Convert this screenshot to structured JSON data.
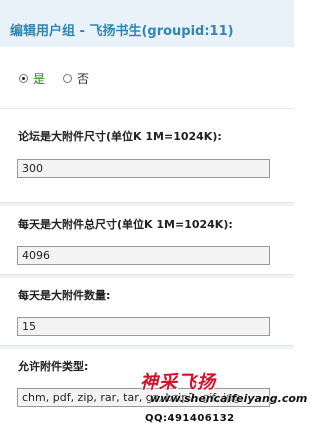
{
  "header": {
    "title": "编辑用户组 - 飞扬书生(groupid:11)"
  },
  "permission": {
    "options": [
      {
        "label": "是",
        "checked": true
      },
      {
        "label": "否",
        "checked": false
      }
    ]
  },
  "fields": [
    {
      "label": "论坛是大附件尺寸(单位K 1M=1024K):",
      "value": "300"
    },
    {
      "label": "每天是大附件总尺寸(单位K 1M=1024K):",
      "value": "4096"
    },
    {
      "label": "每天是大附件数量:",
      "value": "15"
    },
    {
      "label": "允许附件类型:",
      "value": "chm, pdf, zip, rar, tar, gz, bzip2, gif, jpg"
    }
  ],
  "watermark": {
    "brand": "神采飞扬",
    "url": "www.shencaifeiyang.com",
    "qq": "QQ:491406132"
  },
  "colors": {
    "header_bg": "#e9f2f8",
    "header_text": "#2f86b4",
    "watermark": "#d4102a"
  }
}
